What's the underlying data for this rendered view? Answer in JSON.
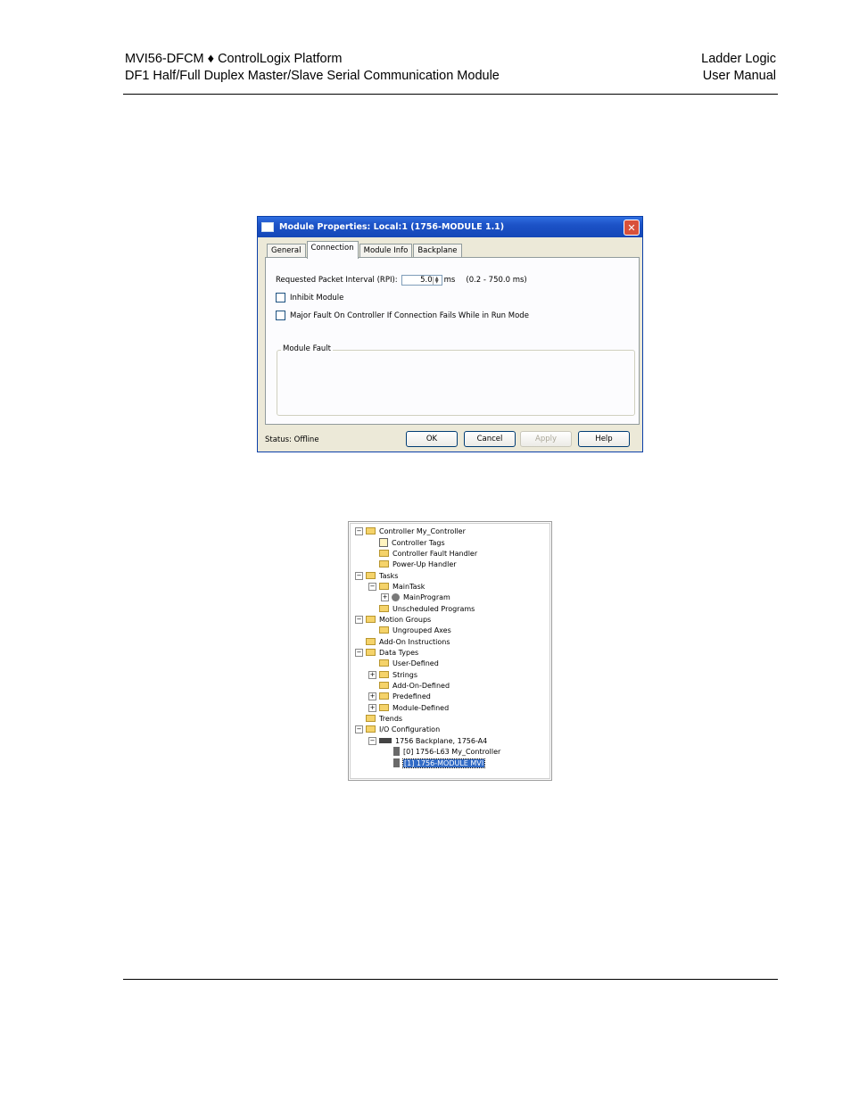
{
  "header": {
    "left_line1": "MVI56-DFCM ♦ ControlLogix Platform",
    "left_line2": "DF1 Half/Full Duplex Master/Slave Serial Communication Module",
    "right_line1": "Ladder Logic",
    "right_line2": "User Manual"
  },
  "dialog": {
    "title": "Module Properties: Local:1 (1756-MODULE 1.1)",
    "close_label": "✕",
    "tabs": [
      {
        "label": "General"
      },
      {
        "label": "Connection"
      },
      {
        "label": "Module Info"
      },
      {
        "label": "Backplane"
      }
    ],
    "rpi_label": "Requested Packet Interval (RPI):",
    "rpi_value": "5.0",
    "rpi_unit": "ms",
    "rpi_range": "(0.2 - 750.0 ms)",
    "inhibit_label": "Inhibit Module",
    "major_fault_label": "Major Fault On Controller If Connection Fails While in Run Mode",
    "module_fault_label": "Module Fault",
    "status_label": "Status:",
    "status_value": "Offline",
    "buttons": {
      "ok": "OK",
      "cancel": "Cancel",
      "apply": "Apply",
      "help": "Help"
    }
  },
  "tree": {
    "items": [
      {
        "label": "Controller My_Controller"
      },
      {
        "label": "Controller Tags"
      },
      {
        "label": "Controller Fault Handler"
      },
      {
        "label": "Power-Up Handler"
      },
      {
        "label": "Tasks"
      },
      {
        "label": "MainTask"
      },
      {
        "label": "MainProgram"
      },
      {
        "label": "Unscheduled Programs"
      },
      {
        "label": "Motion Groups"
      },
      {
        "label": "Ungrouped Axes"
      },
      {
        "label": "Add-On Instructions"
      },
      {
        "label": "Data Types"
      },
      {
        "label": "User-Defined"
      },
      {
        "label": "Strings"
      },
      {
        "label": "Add-On-Defined"
      },
      {
        "label": "Predefined"
      },
      {
        "label": "Module-Defined"
      },
      {
        "label": "Trends"
      },
      {
        "label": "I/O Configuration"
      },
      {
        "label": "1756 Backplane, 1756-A4"
      },
      {
        "label": "[0] 1756-L63 My_Controller"
      },
      {
        "label": "[1] 1756-MODULE MVI"
      }
    ],
    "expander_minus": "−",
    "expander_plus": "+"
  }
}
